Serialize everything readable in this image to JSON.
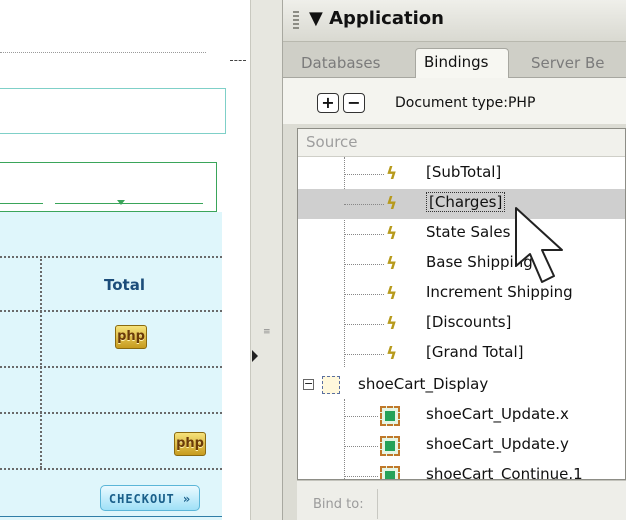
{
  "design": {
    "total_header": "Total",
    "php_badge": "php",
    "checkout_label": "CHECKOUT »"
  },
  "panel": {
    "title": "Application",
    "tabs": [
      "Databases",
      "Bindings",
      "Server Be"
    ],
    "active_tab": "Bindings",
    "toolbar": {
      "add_label": "+",
      "remove_label": "−",
      "doctype_label": "Document type:PHP"
    },
    "tree": {
      "header": "Source",
      "items": [
        {
          "label": "[SubTotal]",
          "icon": "bolt-icon"
        },
        {
          "label": "[Charges]",
          "icon": "bolt-icon",
          "selected": true
        },
        {
          "label": "State Sales",
          "icon": "bolt-icon"
        },
        {
          "label": "Base Shipping",
          "icon": "bolt-icon"
        },
        {
          "label": "Increment Shipping",
          "icon": "bolt-icon"
        },
        {
          "label": "[Discounts]",
          "icon": "bolt-icon"
        },
        {
          "label": "[Grand Total]",
          "icon": "bolt-icon"
        }
      ],
      "group": {
        "label": "shoeCart_Display",
        "toggle": "−",
        "icon": "form-icon"
      },
      "sub_items": [
        {
          "label": "shoeCart_Update.x",
          "icon": "image-field-icon"
        },
        {
          "label": "shoeCart_Update.y",
          "icon": "image-field-icon"
        },
        {
          "label": "shoeCart_Continue.1",
          "icon": "image-field-icon"
        }
      ]
    },
    "bind_to_label": "Bind to:"
  },
  "colors": {
    "selection": "#cfcfcf",
    "bolt": "#b79a1c",
    "design_cyan": "#dff6fb",
    "design_green": "#3aa55a"
  }
}
